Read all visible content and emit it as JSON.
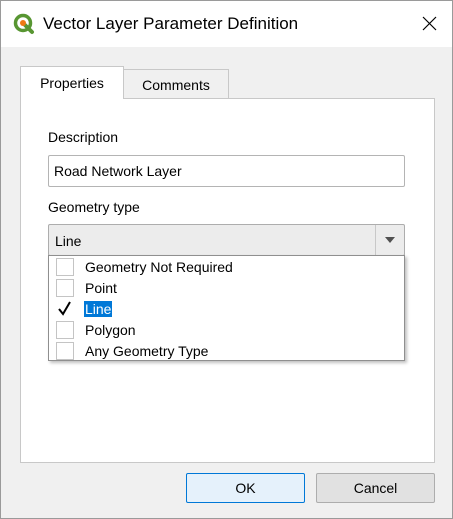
{
  "window": {
    "title": "Vector Layer Parameter Definition",
    "icon": "qgis-logo-icon",
    "close_icon": "close-icon"
  },
  "tabs": [
    {
      "label": "Properties",
      "active": true
    },
    {
      "label": "Comments",
      "active": false
    }
  ],
  "form": {
    "description_label": "Description",
    "description_value": "Road Network Layer",
    "geometry_label": "Geometry type",
    "geometry_selected": "Line",
    "geometry_options": [
      {
        "label": "Geometry Not Required",
        "checked": false
      },
      {
        "label": "Point",
        "checked": false
      },
      {
        "label": "Line",
        "checked": true
      },
      {
        "label": "Polygon",
        "checked": false
      },
      {
        "label": "Any Geometry Type",
        "checked": false
      }
    ]
  },
  "buttons": {
    "ok": "OK",
    "cancel": "Cancel"
  },
  "colors": {
    "selection": "#0078d7",
    "qgis_green": "#589632",
    "qgis_yellow": "#ee7913"
  }
}
